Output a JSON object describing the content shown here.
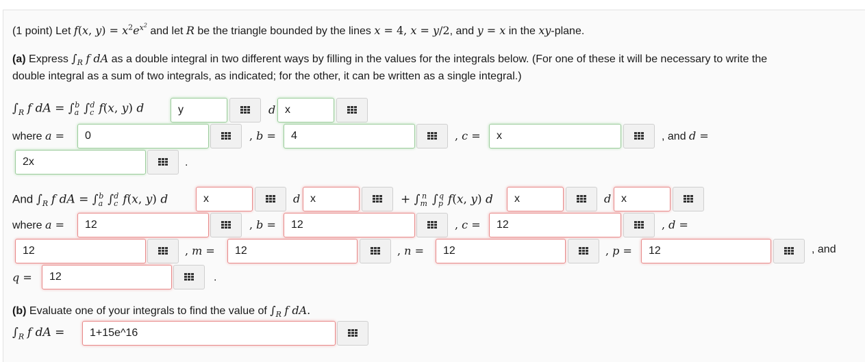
{
  "problem": {
    "intro_points": "(1 point)",
    "intro_let": "Let",
    "intro_and_let": "and let",
    "intro_bounded": "be the triangle bounded by the lines",
    "intro_and": ", and",
    "intro_plane_in": "in the",
    "intro_plane_end": "-plane."
  },
  "part_a": {
    "label": "(a)",
    "express": "Express",
    "text_rest": "as a double integral in two different ways by filling in the values for the integrals below. (For one of these it will be necessary to write the",
    "text_line2": "double integral as a sum of two integrals, as indicated; for the other, it can be written as a single integral.)"
  },
  "words": {
    "where": "where",
    "and": "And",
    "and_d": ", and",
    "and_end": ", and",
    "period": "."
  },
  "inputs": {
    "first_dvar1": "y",
    "first_dvar2": "x",
    "a1": "0",
    "b1": "4",
    "c1": "x",
    "d1": "2x",
    "second_dvar1": "x",
    "second_dvar2": "x",
    "second_dvar3": "x",
    "second_dvar4": "x",
    "a2": "12",
    "b2": "12",
    "c2": "12",
    "d2": "12",
    "m": "12",
    "n": "12",
    "p": "12",
    "q": "12",
    "answer_b": "1+15e^16"
  },
  "part_b": {
    "label": "(b)",
    "text": "Evaluate one of your integrals to find the value of"
  },
  "icons": {
    "math_editor": "equation-editor-grid-icon"
  },
  "colors": {
    "correct_border": "#9ccc9c",
    "incorrect_border": "#e88a8a"
  }
}
